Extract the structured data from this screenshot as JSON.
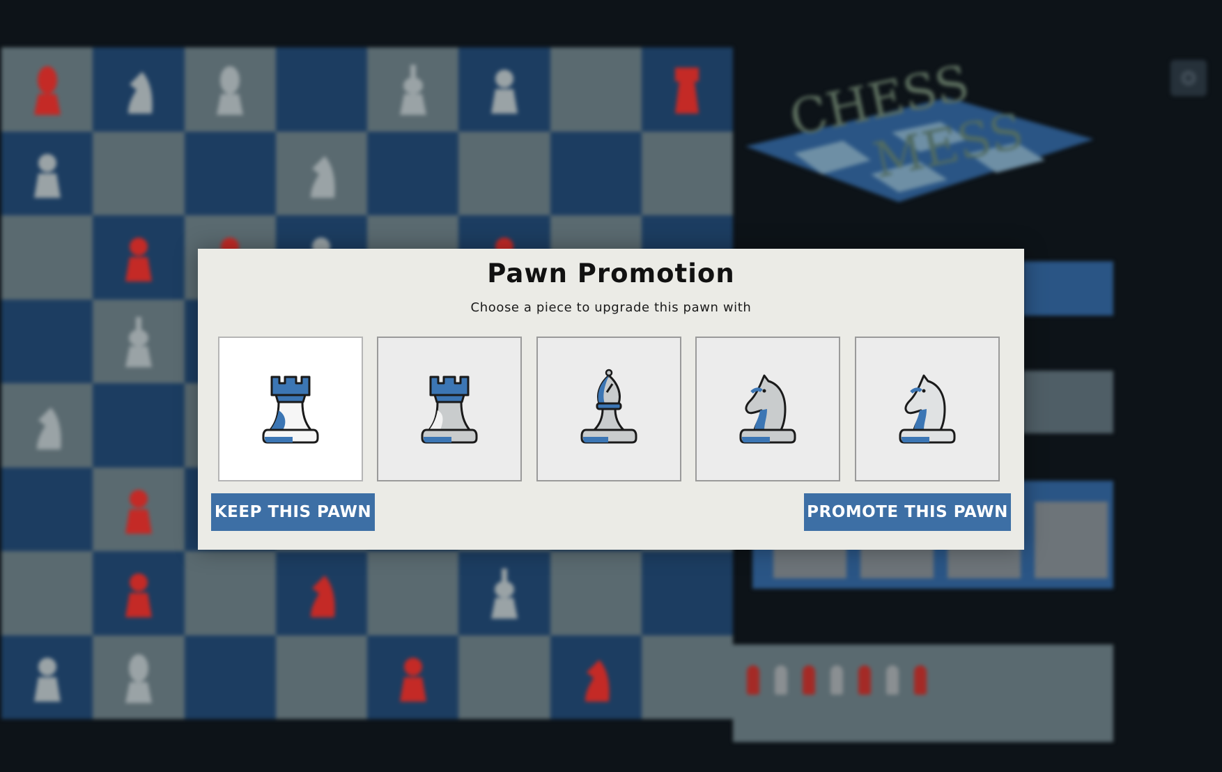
{
  "modal": {
    "title": "Pawn Promotion",
    "subtitle": "Choose a piece to upgrade this pawn with",
    "choices": [
      {
        "piece": "rook-icon",
        "variant": "blue-top",
        "selected": true
      },
      {
        "piece": "rook-icon",
        "variant": "grey-top",
        "selected": false
      },
      {
        "piece": "bishop-icon",
        "variant": "grey",
        "selected": false
      },
      {
        "piece": "knight-icon",
        "variant": "grey",
        "selected": false
      },
      {
        "piece": "knight-icon",
        "variant": "white",
        "selected": false
      }
    ],
    "keep_label": "KEEP THIS PAWN",
    "promote_label": "PROMOTE THIS PAWN"
  },
  "colors": {
    "accent": "#3d6fa5",
    "modal_bg": "#ebebe6",
    "board_light": "#5a6a70",
    "board_dark": "#1c3d61",
    "red_piece": "#c42a26",
    "page_bg": "#0d1318"
  },
  "logo_text": [
    "CHESS",
    "MESS"
  ]
}
